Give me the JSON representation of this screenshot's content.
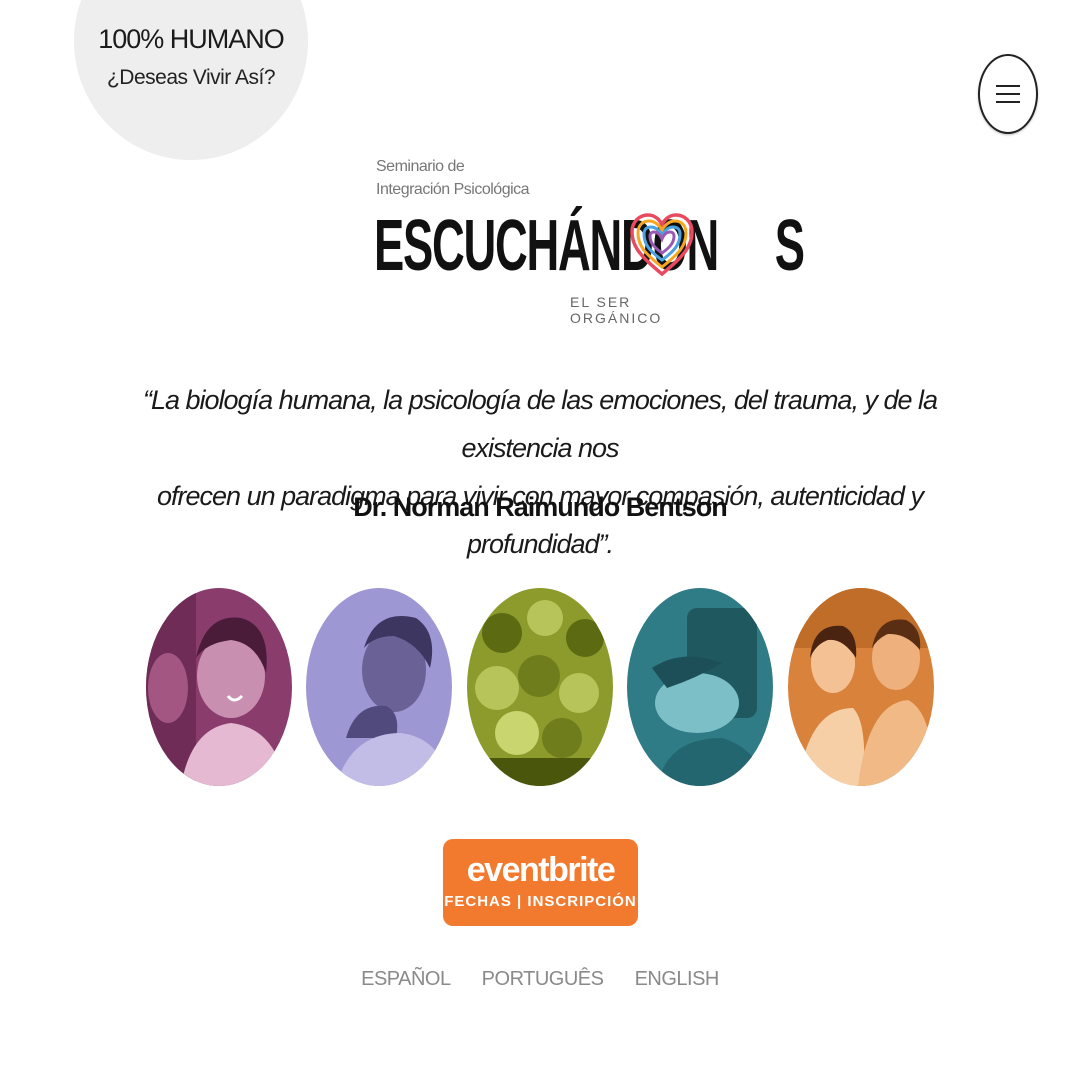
{
  "badge": {
    "title": "100% HUMANO",
    "subtitle": "¿Deseas Vivir Así?"
  },
  "menu": {
    "icon": "hamburger-icon"
  },
  "logo": {
    "line1": "Seminario de",
    "line2": "Integración Psicológica",
    "main_left": "ESCUCHÁNDON",
    "main_right": "S",
    "tagline": "EL SER ORGÁNICO",
    "heart_icon": "rainbow-heart-icon"
  },
  "quote": {
    "line1": "“La biología humana, la psicología de las emociones, del trauma, y de la existencia nos",
    "line2": "ofrecen un paradigma para vivir con mayor compasión, autenticidad y profundidad”.",
    "author": "Dr. Norman Raimundo Bentson"
  },
  "photos": [
    {
      "name": "woman-smiling-photo",
      "tint": "#8a3c6c"
    },
    {
      "name": "man-thinking-photo",
      "tint": "#8f88c9"
    },
    {
      "name": "group-friends-photo",
      "tint": "#8d9a2c"
    },
    {
      "name": "woman-lying-photo",
      "tint": "#2f7b86"
    },
    {
      "name": "couple-photo",
      "tint": "#d9823c"
    }
  ],
  "cta": {
    "brand": "eventbrite",
    "label": "FECHAS | INSCRIPCIÓN",
    "color": "#f27a2e"
  },
  "languages": [
    "ESPAÑOL",
    "PORTUGUÊS",
    "ENGLISH"
  ]
}
